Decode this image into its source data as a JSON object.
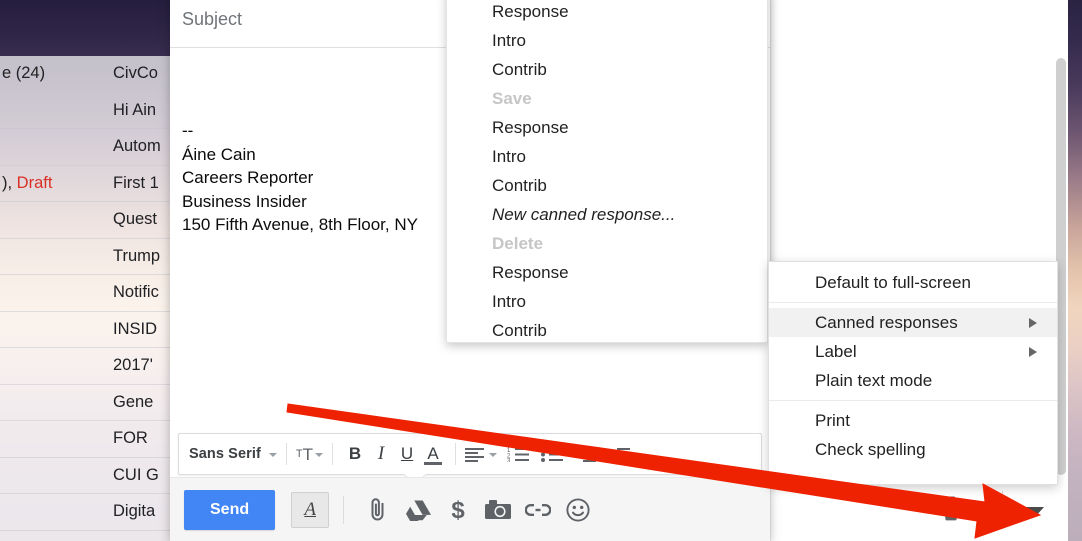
{
  "desktop": {
    "wallpaper_top_color": "#2a2342",
    "wallpaper_bottom_color": "#bdaebc"
  },
  "mail_list": {
    "rows": [
      {
        "left": "e (24)",
        "draft": "",
        "subject": "CivCo"
      },
      {
        "left": "",
        "draft": "",
        "subject": "Hi Ain"
      },
      {
        "left": "",
        "draft": "",
        "subject": "Autom"
      },
      {
        "left": "), ",
        "draft": "Draft",
        "subject": "First 1"
      },
      {
        "left": "",
        "draft": "",
        "subject": "Quest"
      },
      {
        "left": "",
        "draft": "",
        "subject": "Trump"
      },
      {
        "left": "",
        "draft": "",
        "subject": "Notific"
      },
      {
        "left": "",
        "draft": "",
        "subject": "INSID"
      },
      {
        "left": "",
        "draft": "",
        "subject": "2017'"
      },
      {
        "left": "",
        "draft": "",
        "subject": "Gene"
      },
      {
        "left": "",
        "draft": "",
        "subject": "FOR "
      },
      {
        "left": "",
        "draft": "",
        "subject": "CUI G"
      },
      {
        "left": "",
        "draft": "",
        "subject": "Digita"
      }
    ],
    "draft_color": "#d93025"
  },
  "compose": {
    "subject_placeholder": "Subject",
    "subject_value": "",
    "signature": [
      "--",
      "Áine Cain",
      "Careers Reporter",
      "Business Insider",
      "150 Fifth Avenue, 8th Floor, NY"
    ],
    "toolbar": {
      "font_name": "Sans Serif",
      "font_caret_icon": "chevron-down-icon",
      "size_icon": "text-size-icon",
      "size_caret_icon": "chevron-down-icon",
      "bold_label": "B",
      "italic_label": "I",
      "underline_label": "U",
      "text_color_label": "A",
      "align_icon": "align-left-icon",
      "align_caret_icon": "chevron-down-icon",
      "numbered_list_icon": "numbered-list-icon",
      "bulleted_list_icon": "bulleted-list-icon",
      "outdent_icon": "outdent-icon",
      "indent_icon": "indent-icon"
    },
    "sendbar": {
      "send_label": "Send",
      "format_toggle_label": "A",
      "format_toggle_icon": "formatting-options-icon",
      "attach_icon": "paperclip-icon",
      "drive_icon": "google-drive-icon",
      "money_icon": "dollar-sign-icon",
      "photo_icon": "camera-icon",
      "link_icon": "link-icon",
      "emoji_icon": "emoji-smiley-icon",
      "trash_icon": "trash-can-icon",
      "more_options_icon": "chevron-down-icon"
    },
    "send_button_color": "#4285f4"
  },
  "canned_responses_menu": {
    "items": [
      {
        "label": "Response",
        "state": "normal",
        "style": "normal"
      },
      {
        "label": "Intro",
        "state": "normal",
        "style": "normal"
      },
      {
        "label": "Contrib",
        "state": "normal",
        "style": "normal"
      },
      {
        "label": "Save",
        "state": "disabled",
        "style": "normal"
      },
      {
        "label": "Response",
        "state": "normal",
        "style": "normal"
      },
      {
        "label": "Intro",
        "state": "normal",
        "style": "normal"
      },
      {
        "label": "Contrib",
        "state": "normal",
        "style": "normal"
      },
      {
        "label": "New canned response...",
        "state": "normal",
        "style": "italic"
      },
      {
        "label": "Delete",
        "state": "disabled",
        "style": "normal"
      },
      {
        "label": "Response",
        "state": "normal",
        "style": "normal"
      },
      {
        "label": "Intro",
        "state": "normal",
        "style": "normal"
      },
      {
        "label": "Contrib",
        "state": "normal",
        "style": "normal"
      }
    ]
  },
  "context_menu": {
    "items": [
      {
        "label": "Default to full-screen",
        "submenu": false,
        "highlighted": false
      },
      {
        "label": "Canned responses",
        "submenu": true,
        "highlighted": true
      },
      {
        "label": "Label",
        "submenu": true,
        "highlighted": false
      },
      {
        "label": "Plain text mode",
        "submenu": false,
        "highlighted": false
      },
      {
        "label": "Print",
        "submenu": false,
        "highlighted": false
      },
      {
        "label": "Check spelling",
        "submenu": false,
        "highlighted": false
      }
    ],
    "highlight_color": "#f1f1f1"
  },
  "annotation": {
    "arrow_color": "#ee2200",
    "arrow_start": "288,404",
    "arrow_end": "1020,518"
  }
}
